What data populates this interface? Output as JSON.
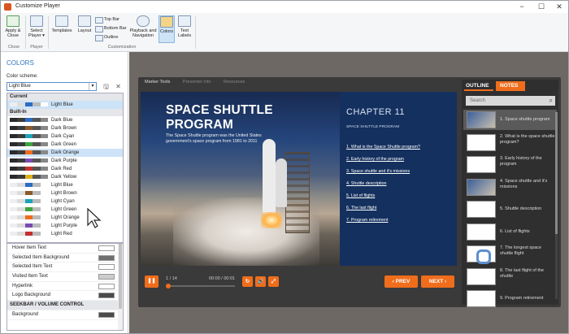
{
  "window": {
    "title": "Customize Player"
  },
  "ribbon": {
    "buttons": [
      {
        "label": "Apply & Close"
      },
      {
        "label": "Select Player ▾"
      },
      {
        "label": "Templates"
      },
      {
        "label": "Layout"
      },
      {
        "label": "Playback and Navigation"
      },
      {
        "label": "Colors"
      },
      {
        "label": "Text Labels"
      }
    ],
    "small": [
      "Top Bar",
      "Bottom Bar",
      "Outline"
    ],
    "groups": [
      "Close",
      "Player",
      "Customization"
    ]
  },
  "left": {
    "header": "COLORS",
    "scheme_label": "Color scheme:",
    "scheme_value": "Light Blue",
    "current_header": "Current",
    "current_item": "Light Blue",
    "builtin_header": "Built-In",
    "schemes": [
      {
        "name": "Dark Blue",
        "colors": [
          "#2a2a2a",
          "#3a3a3a",
          "#2b6cc4",
          "#555",
          "#888"
        ]
      },
      {
        "name": "Dark Brown",
        "colors": [
          "#2a2a2a",
          "#3a3a3a",
          "#8a5a2b",
          "#555",
          "#888"
        ]
      },
      {
        "name": "Dark Cyan",
        "colors": [
          "#2a2a2a",
          "#3a3a3a",
          "#1aa3b8",
          "#555",
          "#888"
        ]
      },
      {
        "name": "Dark Green",
        "colors": [
          "#2a2a2a",
          "#3a3a3a",
          "#3fa33f",
          "#555",
          "#888"
        ]
      },
      {
        "name": "Dark Orange",
        "colors": [
          "#2a2a2a",
          "#3a3a3a",
          "#f06d1c",
          "#555",
          "#888"
        ]
      },
      {
        "name": "Dark Purple",
        "colors": [
          "#2a2a2a",
          "#3a3a3a",
          "#7a4cb0",
          "#555",
          "#888"
        ]
      },
      {
        "name": "Dark Red",
        "colors": [
          "#2a2a2a",
          "#3a3a3a",
          "#c43030",
          "#555",
          "#888"
        ]
      },
      {
        "name": "Dark Yellow",
        "colors": [
          "#2a2a2a",
          "#3a3a3a",
          "#d8b21a",
          "#555",
          "#888"
        ]
      },
      {
        "name": "Light Blue",
        "colors": [
          "#eee",
          "#ddd",
          "#2b6cc4",
          "#bbb",
          "#fff"
        ]
      },
      {
        "name": "Light Brown",
        "colors": [
          "#eee",
          "#ddd",
          "#8a5a2b",
          "#bbb",
          "#fff"
        ]
      },
      {
        "name": "Light Cyan",
        "colors": [
          "#eee",
          "#ddd",
          "#1aa3b8",
          "#bbb",
          "#fff"
        ]
      },
      {
        "name": "Light Green",
        "colors": [
          "#eee",
          "#ddd",
          "#3fa33f",
          "#bbb",
          "#fff"
        ]
      },
      {
        "name": "Light Orange",
        "colors": [
          "#eee",
          "#ddd",
          "#f06d1c",
          "#bbb",
          "#fff"
        ]
      },
      {
        "name": "Light Purple",
        "colors": [
          "#eee",
          "#ddd",
          "#7a4cb0",
          "#bbb",
          "#fff"
        ]
      },
      {
        "name": "Light Red",
        "colors": [
          "#eee",
          "#ddd",
          "#c43030",
          "#bbb",
          "#fff"
        ]
      }
    ],
    "properties": [
      {
        "label": "Hover Item Text",
        "color": "#ffffff"
      },
      {
        "label": "Selected Item Background",
        "color": "#6e6e6e"
      },
      {
        "label": "Selected Item Text",
        "color": "#ffffff"
      },
      {
        "label": "Visited Item Text",
        "color": "#cccccc"
      },
      {
        "label": "Hyperlink",
        "color": "#ffffff"
      },
      {
        "label": "Logo Background",
        "color": "#4a4a4a"
      }
    ],
    "seekbar_header": "SEEKBAR / VOLUME CONTROL",
    "seekbar_props": [
      {
        "label": "Background",
        "color": "#4a4a4a"
      }
    ]
  },
  "player": {
    "top_tabs": [
      "Marker Tools",
      "Presenter Info",
      "Resources"
    ],
    "slide": {
      "title": "SPACE SHUTTLE PROGRAM",
      "description": "The Space Shuttle program was the United States government's space program from 1981 to 2011",
      "chapter": "CHAPTER 11",
      "chapter_sub": "SPACE SHUTTLE PROGRAM",
      "toc": [
        "1. What is the Space Shuttle program?",
        "2. Early history of the program",
        "3. Space shuttle and it's missions",
        "4. Shuttle description",
        "5. List of flights",
        "6. The last flight",
        "7. Program retirement"
      ]
    },
    "controls": {
      "pause": "❚❚",
      "slide_count": "1 / 14",
      "time": "00:00 / 00:01",
      "prev": "‹ PREV",
      "next": "NEXT ›"
    },
    "sidebar": {
      "tab_outline": "OUTLINE",
      "tab_notes": "NOTES",
      "search_placeholder": "Search",
      "items": [
        "1. Space shuttle program",
        "2. What is the space shuttle program?",
        "3. Early history of the program",
        "4. Space shuttle and it's missions",
        "5. Shuttle description",
        "6. List of flights",
        "7. The longest space shuttle flight",
        "8. The last flight of the shuttle",
        "9. Program retirement"
      ]
    }
  },
  "accent_color": "#f06d1c"
}
